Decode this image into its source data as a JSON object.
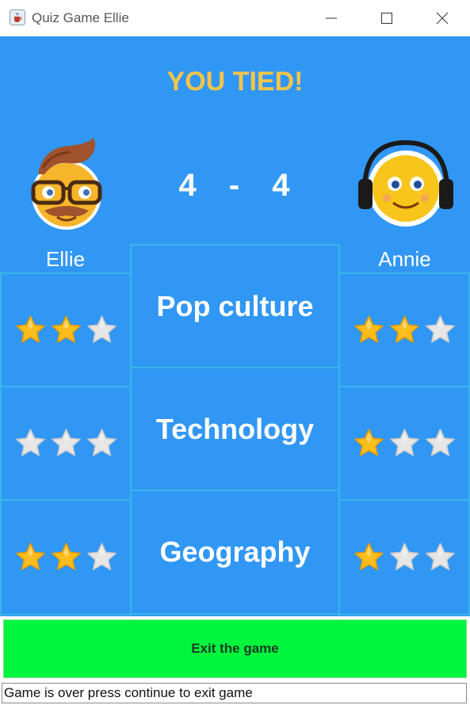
{
  "window": {
    "title": "Quiz Game Ellie",
    "icon": "java-cup-icon",
    "controls": [
      "minimize-icon",
      "maximize-icon",
      "close-icon"
    ]
  },
  "result": {
    "headline": "YOU TIED!",
    "score_left": "4",
    "score_separator": "-",
    "score_right": "4"
  },
  "players": {
    "left": {
      "name": "Ellie",
      "avatar": "hipster-emoji-icon"
    },
    "right": {
      "name": "Annie",
      "avatar": "headphones-emoji-icon"
    }
  },
  "rounds": [
    {
      "category": "Pop culture",
      "left_stars_filled": 2,
      "right_stars_filled": 2
    },
    {
      "category": "Technology",
      "left_stars_filled": 0,
      "right_stars_filled": 1
    },
    {
      "category": "Geography",
      "left_stars_filled": 2,
      "right_stars_filled": 1
    }
  ],
  "stars_total": 3,
  "exit_button": {
    "label": "Exit the game"
  },
  "status_text": "Game is over press continue to exit game",
  "colors": {
    "background": "#3197f4",
    "headline": "#f3c54b",
    "cell_border": "#37b6e9",
    "star_filled": "#fbbd1c",
    "star_empty": "#e6e6e6",
    "exit_button": "#00f53d"
  }
}
